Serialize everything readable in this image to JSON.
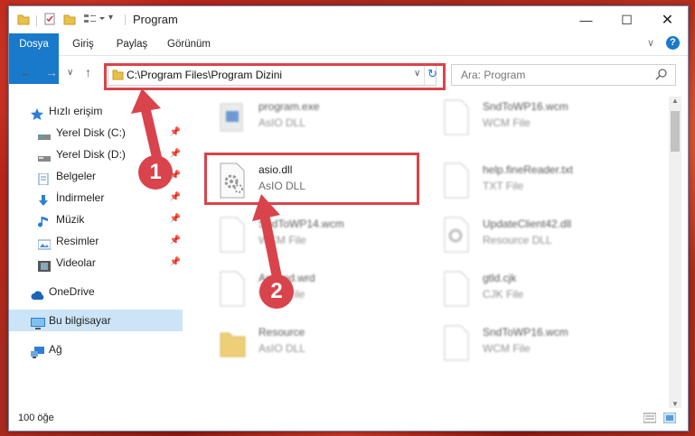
{
  "window": {
    "title": "Program"
  },
  "ribbon": {
    "tabs": [
      "Dosya",
      "Giriş",
      "Paylaş",
      "Görünüm"
    ]
  },
  "address": {
    "path": "C:\\Program Files\\Program Dizini"
  },
  "search": {
    "placeholder": "Ara: Program"
  },
  "sidebar": {
    "items": [
      {
        "label": "Hızlı erişim",
        "icon": "star-icon"
      },
      {
        "label": "Yerel Disk (C:)",
        "icon": "drive-icon",
        "pinned": true
      },
      {
        "label": "Yerel Disk (D:)",
        "icon": "drive-icon",
        "pinned": true
      },
      {
        "label": "Belgeler",
        "icon": "document-icon",
        "pinned": true
      },
      {
        "label": "İndirmeler",
        "icon": "download-icon",
        "pinned": true
      },
      {
        "label": "Müzik",
        "icon": "music-icon",
        "pinned": true
      },
      {
        "label": "Resimler",
        "icon": "picture-icon",
        "pinned": true
      },
      {
        "label": "Videolar",
        "icon": "video-icon",
        "pinned": true
      },
      {
        "label": "OneDrive",
        "icon": "cloud-icon"
      },
      {
        "label": "Bu bilgisayar",
        "icon": "computer-icon",
        "selected": true
      },
      {
        "label": "Ağ",
        "icon": "network-icon"
      }
    ]
  },
  "files": [
    {
      "name": "program.exe",
      "type": "AsIO DLL"
    },
    {
      "name": "SndToWP16.wcm",
      "type": "WCM File"
    },
    {
      "name": "asio.dll",
      "type": "AsIO DLL"
    },
    {
      "name": "help.fineReader.txt",
      "type": "TXT File"
    },
    {
      "name": "SndToWP14.wcm",
      "type": "WCM File"
    },
    {
      "name": "UpdateClient42.dll",
      "type": "Resource DLL"
    },
    {
      "name": "Ascend.wrd",
      "type": "WRD File"
    },
    {
      "name": "gtld.cjk",
      "type": "CJK File"
    },
    {
      "name": "Resource",
      "type": "AsIO DLL"
    },
    {
      "name": "SndToWP16.wcm",
      "type": "WCM File"
    }
  ],
  "status": {
    "count": "100 öğe"
  },
  "annotations": {
    "step1": "1",
    "step2": "2"
  },
  "colors": {
    "highlight": "#d9434b",
    "accent": "#1979ca"
  }
}
